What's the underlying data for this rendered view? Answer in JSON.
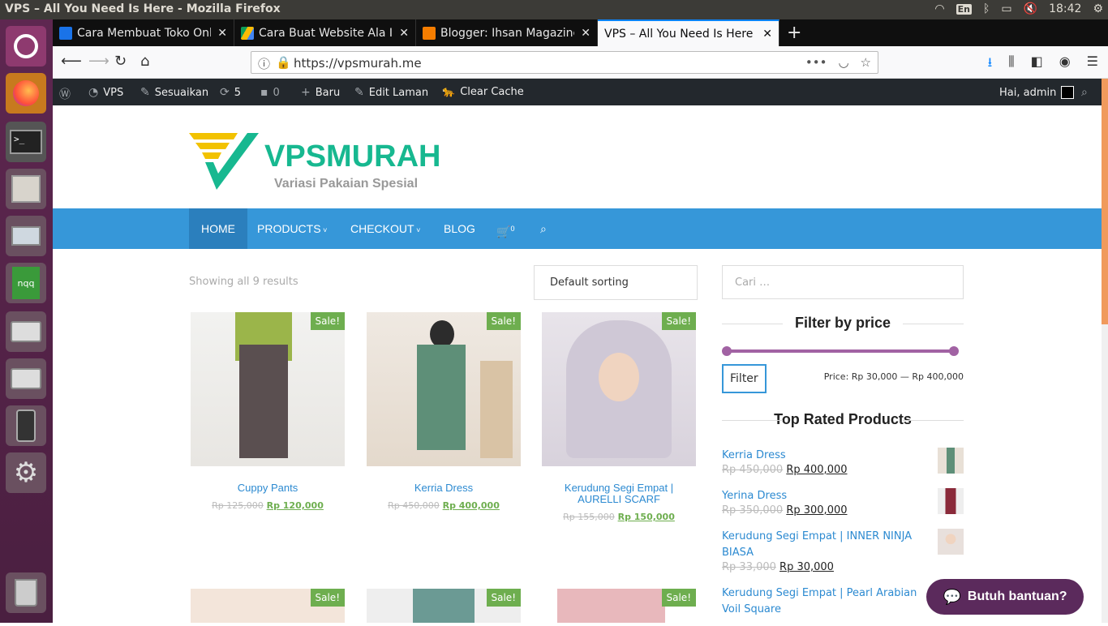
{
  "system": {
    "window_title": "VPS – All You Need Is Here - Mozilla Firefox",
    "keyboard_layout": "En",
    "clock": "18:42"
  },
  "launcher": {
    "items": [
      "ubuntu-logo-icon",
      "firefox-icon",
      "terminal-icon",
      "file-manager-icon",
      "remote-desktop-icon",
      "nqq-icon",
      "disk-drive-icon",
      "disk-drive-icon",
      "phone-icon",
      "system-settings-icon",
      "trash-icon"
    ],
    "nqq_label": "nqq"
  },
  "browser": {
    "tabs": [
      {
        "label": "Cara Membuat Toko Onl",
        "color": "#1a73e8"
      },
      {
        "label": "Cara Buat Website Ala II",
        "color": "#fbbc04"
      },
      {
        "label": "Blogger: Ihsan Magazine",
        "color": "#f57d00"
      },
      {
        "label": "VPS – All You Need Is Here",
        "color": ""
      }
    ],
    "url": "https://vpsmurah.me"
  },
  "wp_admin_bar": {
    "site": "VPS",
    "customize": "Sesuaikan",
    "updates": "5",
    "comments": "0",
    "new": "Baru",
    "edit_page": "Edit Laman",
    "clear_cache": "Clear Cache",
    "greeting": "Hai, admin"
  },
  "site": {
    "brand": "VPSMURAH",
    "tagline": "Variasi Pakaian Spesial",
    "accent": "#3697d9",
    "menu": [
      "HOME",
      "PRODUCTS",
      "CHECKOUT",
      "BLOG"
    ],
    "cart_count": "0",
    "results_text": "Showing all 9 results",
    "sorting": "Default sorting",
    "sale_label": "Sale!",
    "products": [
      {
        "name": "Cuppy Pants",
        "old_price": "Rp 125,000",
        "new_price": "Rp 120,000"
      },
      {
        "name": "Kerria Dress",
        "old_price": "Rp 450,000",
        "new_price": "Rp 400,000"
      },
      {
        "name": "Kerudung Segi Empat | AURELLI SCARF",
        "old_price": "Rp 155,000",
        "new_price": "Rp 150,000"
      }
    ]
  },
  "sidebar": {
    "search_placeholder": "Cari …",
    "filter_title": "Filter by price",
    "filter_button": "Filter",
    "price_range": "Price: Rp 30,000 — Rp 400,000",
    "top_rated_title": "Top Rated Products",
    "top_rated": [
      {
        "name": "Kerria Dress",
        "old_price": "Rp 450,000",
        "new_price": "Rp 400,000"
      },
      {
        "name": "Yerina Dress",
        "old_price": "Rp 350,000",
        "new_price": "Rp 300,000"
      },
      {
        "name": "Kerudung Segi Empat | INNER NINJA BIASA",
        "old_price": "Rp 33,000",
        "new_price": "Rp 30,000"
      },
      {
        "name": "Kerudung Segi Empat | Pearl Arabian Voil Square",
        "old_price": "",
        "new_price": ""
      }
    ]
  },
  "chat": {
    "label": "Butuh bantuan?"
  }
}
